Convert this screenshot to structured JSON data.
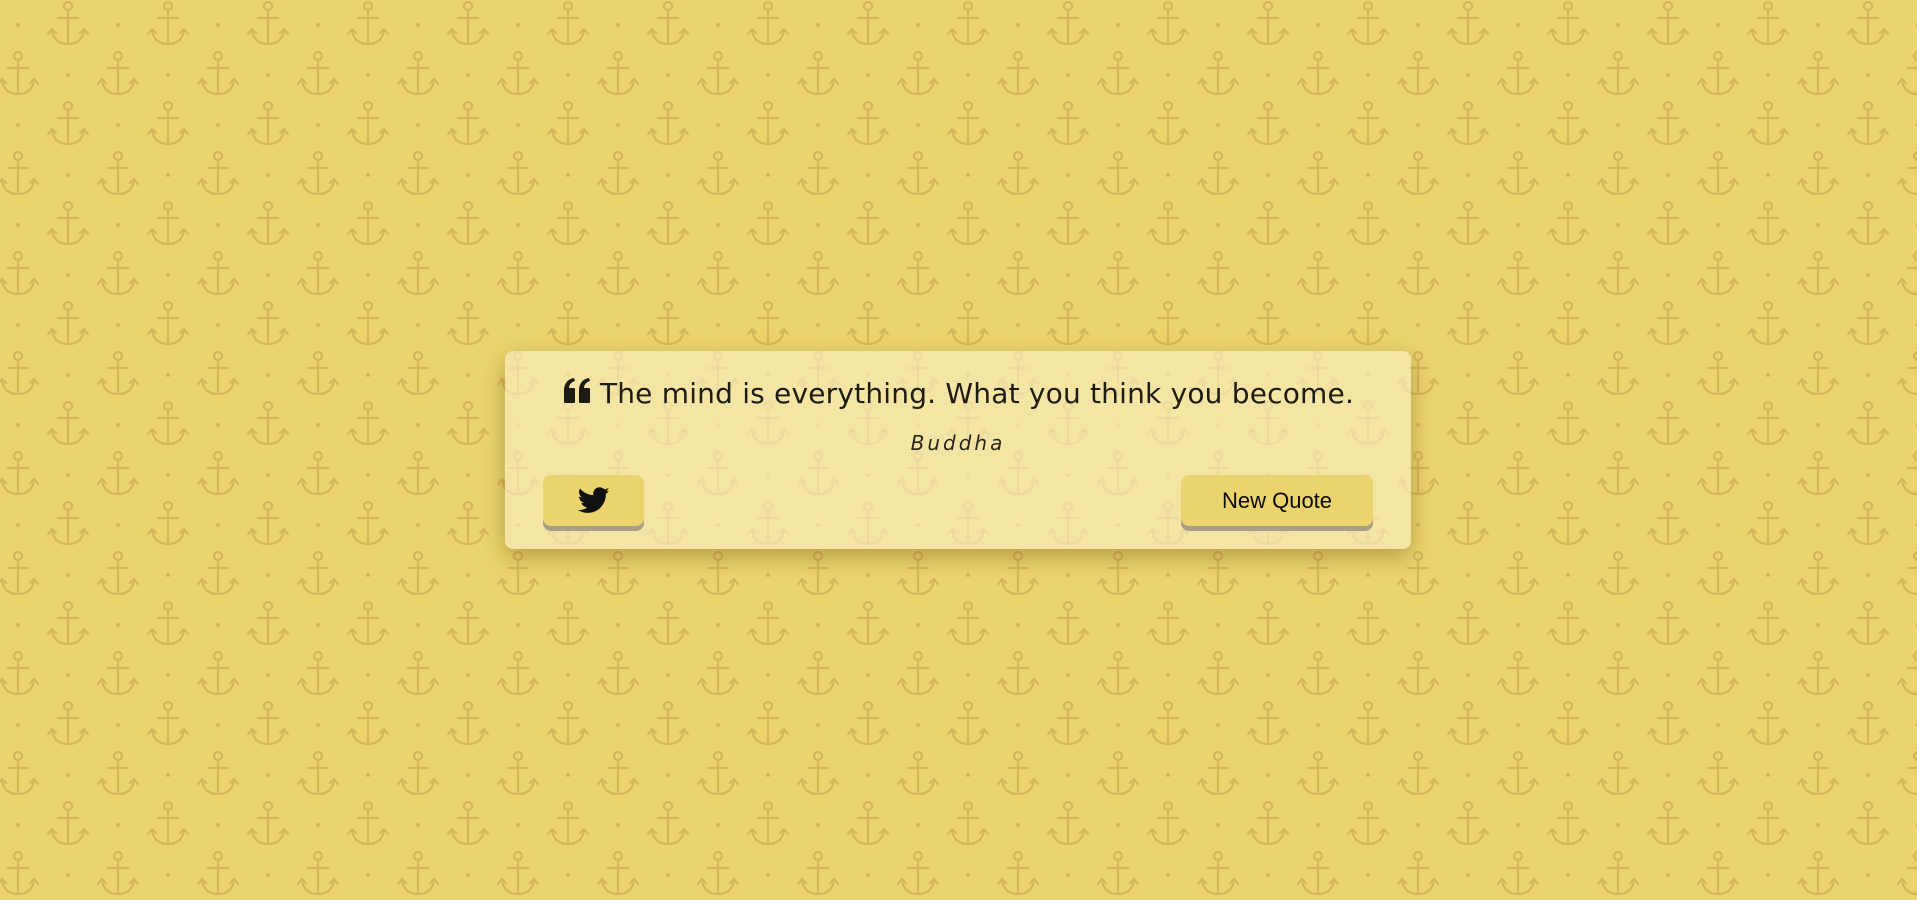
{
  "quote": {
    "text": "The mind is everything. What you think you become.",
    "author": "Buddha",
    "icon": "quote-left-icon"
  },
  "actions": {
    "tweet_icon": "twitter-icon",
    "new_quote_label": "New Quote"
  },
  "colors": {
    "background": "#ebd36d",
    "pattern": "#d4b65a",
    "card": "#f3e6a8",
    "button": "#ebd36d",
    "button_shadow": "#a99e85",
    "text": "#1d1b12"
  }
}
